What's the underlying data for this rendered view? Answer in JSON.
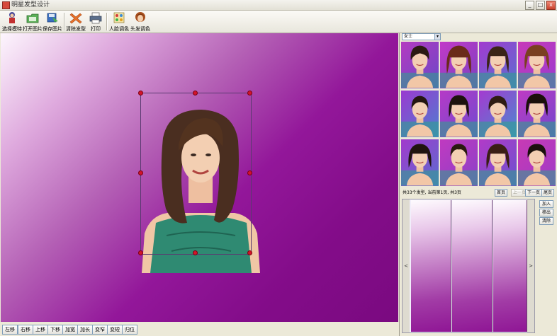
{
  "window": {
    "title": "明星发型设计",
    "min": "_",
    "max": "□",
    "close": "x"
  },
  "toolbar": [
    {
      "label": "选择模特",
      "icon": "model-icon",
      "name": "select-model-button"
    },
    {
      "label": "打开图片",
      "icon": "open-image-icon",
      "name": "open-image-button"
    },
    {
      "label": "保存图片",
      "icon": "save-image-icon",
      "name": "save-image-button"
    },
    {
      "label": "清除发型",
      "icon": "clear-hairstyle-icon",
      "name": "clear-hairstyle-button"
    },
    {
      "label": "打印",
      "icon": "printer-icon",
      "name": "print-button"
    },
    {
      "label": "人脸调色",
      "icon": "face-color-icon",
      "name": "face-color-button"
    },
    {
      "label": "头发调色",
      "icon": "hair-color-icon",
      "name": "hair-color-button"
    }
  ],
  "bottom_buttons": [
    "左移",
    "右移",
    "上移",
    "下移",
    "加宽",
    "加长",
    "变窄",
    "变短",
    "归位"
  ],
  "right": {
    "category": {
      "value": "女士",
      "arrow": "▾"
    },
    "page_info": "共33个发型, 当前第1页, 共3页",
    "nav": {
      "first": "首页",
      "prev": "上一页",
      "next": "下一页",
      "last": "尾页"
    },
    "scroll_left": "<",
    "scroll_right": ">",
    "side_buttons": [
      "加入",
      "移出",
      "清除"
    ]
  },
  "colors": {
    "accent": "#830c89",
    "handle": "#d2142b"
  },
  "thumbnail_count": 12
}
